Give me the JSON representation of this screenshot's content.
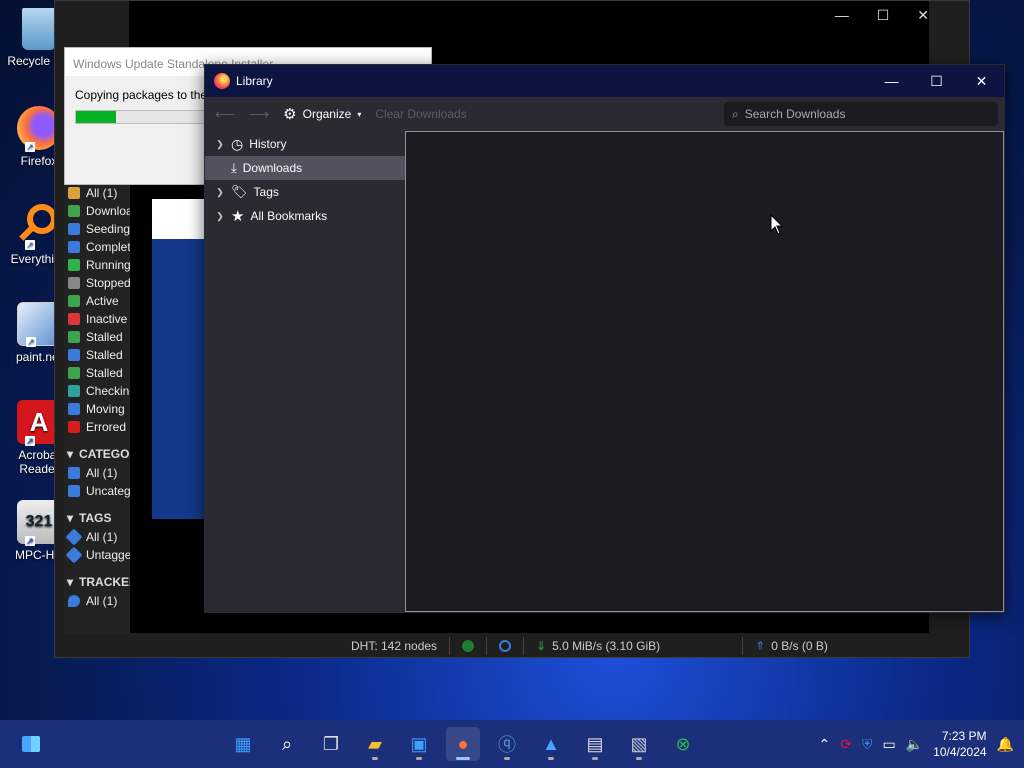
{
  "desktop": {
    "icons": [
      {
        "label": "Recycle Bin",
        "icon": "recycle-bin-icon"
      },
      {
        "label": "Firefox",
        "icon": "firefox-icon"
      },
      {
        "label": "Everything",
        "icon": "everything-icon"
      },
      {
        "label": "paint.net",
        "icon": "paintnet-icon"
      },
      {
        "label": "Acrobat Reader",
        "icon": "acrobat-icon"
      },
      {
        "label": "MPC-HC",
        "icon": "mpc-hc-icon"
      }
    ]
  },
  "qbittorrent": {
    "status_filters": [
      {
        "label": "All (1)",
        "color": "#d9a23a"
      },
      {
        "label": "Downloading",
        "color": "#3fa34d"
      },
      {
        "label": "Seeding",
        "color": "#3b7bdc"
      },
      {
        "label": "Completed",
        "color": "#3b7bdc"
      },
      {
        "label": "Running",
        "color": "#2fb34a"
      },
      {
        "label": "Stopped",
        "color": "#888888"
      },
      {
        "label": "Active",
        "color": "#3fa34d"
      },
      {
        "label": "Inactive",
        "color": "#d93636"
      },
      {
        "label": "Stalled",
        "color": "#3fa34d"
      },
      {
        "label": "Stalled",
        "color": "#3b7bdc"
      },
      {
        "label": "Stalled",
        "color": "#3fa34d"
      },
      {
        "label": "Checking",
        "color": "#2fa39a"
      },
      {
        "label": "Moving",
        "color": "#3b7bdc"
      },
      {
        "label": "Errored",
        "color": "#d91d1d"
      }
    ],
    "categories_header": "CATEGORIES",
    "categories": [
      "All (1)",
      "Uncategorized"
    ],
    "tags_header": "TAGS",
    "tags": [
      "All (1)",
      "Untagged"
    ],
    "trackers_header": "TRACKERS",
    "trackers": [
      "All (1)"
    ],
    "status_bar": {
      "dht": "DHT: 142 nodes",
      "download": "5.0 MiB/s (3.10 GiB)",
      "upload": "0 B/s (0 B)"
    }
  },
  "installer": {
    "title": "Windows Update Standalone Installer",
    "message": "Copying packages to the",
    "progress": 0.2
  },
  "library": {
    "title": "Library",
    "toolbar": {
      "organize_label": "Organize",
      "clear_downloads_label": "Clear Downloads",
      "search_placeholder": "Search Downloads"
    },
    "tree": [
      {
        "label": "History",
        "icon": "clock-icon",
        "expandable": true,
        "selected": false
      },
      {
        "label": "Downloads",
        "icon": "download-icon",
        "expandable": false,
        "selected": true
      },
      {
        "label": "Tags",
        "icon": "tag-icon",
        "expandable": true,
        "selected": false
      },
      {
        "label": "All Bookmarks",
        "icon": "star-icon",
        "expandable": true,
        "selected": false
      }
    ]
  },
  "taskbar": {
    "clock_time": "7:23 PM",
    "clock_date": "10/4/2024",
    "apps": [
      "start-icon",
      "search-icon",
      "task-view-icon",
      "file-explorer-icon",
      "store-icon",
      "firefox-icon",
      "qbittorrent-icon",
      "photos-icon",
      "notepad-icon",
      "installer-icon",
      "xbox-icon"
    ]
  }
}
